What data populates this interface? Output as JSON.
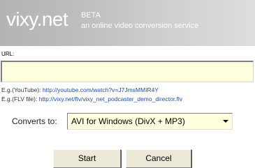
{
  "header": {
    "logo": "vixy.net",
    "beta": "BETA",
    "tagline": "an online video conversion service"
  },
  "form": {
    "url_label": "URL:",
    "url_value": "",
    "examples": [
      {
        "label": "E.g.(YouTube): ",
        "link": "http://youtube.com/watch?v=J7JmsMMIR4Y"
      },
      {
        "label": "E.g.(FLV file): ",
        "link": "http://vixy.net/flv/vixy_net_podcaster_demo_director.flv"
      }
    ],
    "converts_label": "Converts to:",
    "format_selected": "AVI for Windows (DivX + MP3)"
  },
  "buttons": {
    "start": "Start",
    "cancel": "Cancel"
  },
  "colors": {
    "input_background": "#ffffe0",
    "link": "#1f4f9e",
    "header_gray": "#bdbdbd"
  }
}
